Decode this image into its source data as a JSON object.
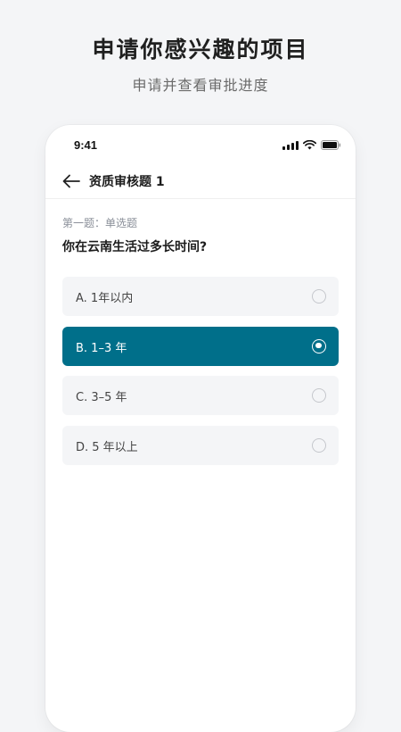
{
  "promo": {
    "title": "申请你感兴趣的项目",
    "subtitle": "申请并查看审批进度"
  },
  "status_bar": {
    "time": "9:41",
    "icons": [
      "signal-icon",
      "wifi-icon",
      "battery-icon"
    ]
  },
  "nav": {
    "back_icon": "arrow-left-icon",
    "title": "资质审核题 1"
  },
  "question": {
    "label": "第一题：单选题",
    "text": "你在云南生活过多长时间?"
  },
  "options": [
    {
      "label": "A.  1年以内",
      "selected": false
    },
    {
      "label": "B.  1–3 年",
      "selected": true
    },
    {
      "label": "C.  3–5 年",
      "selected": false
    },
    {
      "label": "D.  5 年以上",
      "selected": false
    }
  ],
  "colors": {
    "accent": "#006f8a",
    "background": "#f4f5f7",
    "option_background": "#f4f5f7",
    "card": "#ffffff"
  }
}
